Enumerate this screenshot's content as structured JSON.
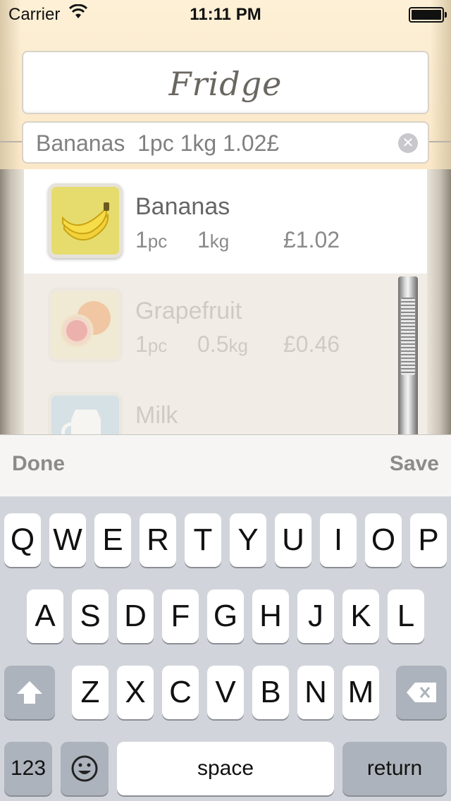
{
  "status_bar": {
    "carrier": "Carrier",
    "time": "11:11 PM"
  },
  "app": {
    "title": "Fridge"
  },
  "search": {
    "value": "Bananas  1pc 1kg 1.02£",
    "clear_icon": "clear-icon"
  },
  "items": [
    {
      "name": "Bananas",
      "qty": "1",
      "qty_unit": "pc",
      "weight": "1",
      "weight_unit": "kg",
      "price": "£1.02",
      "image": "banana-image"
    },
    {
      "name": "Grapefruit",
      "qty": "1",
      "qty_unit": "pc",
      "weight": "0.5",
      "weight_unit": "kg",
      "price": "£0.46",
      "image": "grapefruit-image"
    },
    {
      "name": "Milk",
      "image": "milk-jug-image"
    }
  ],
  "accessory": {
    "done": "Done",
    "save": "Save"
  },
  "keyboard": {
    "row1": [
      "Q",
      "W",
      "E",
      "R",
      "T",
      "Y",
      "U",
      "I",
      "O",
      "P"
    ],
    "row2": [
      "A",
      "S",
      "D",
      "F",
      "G",
      "H",
      "J",
      "K",
      "L"
    ],
    "row3": [
      "Z",
      "X",
      "C",
      "V",
      "B",
      "N",
      "M"
    ],
    "numbers": "123",
    "space": "space",
    "return": "return",
    "shift_icon": "shift-icon",
    "delete_icon": "delete-icon",
    "emoji_icon": "emoji-icon"
  }
}
